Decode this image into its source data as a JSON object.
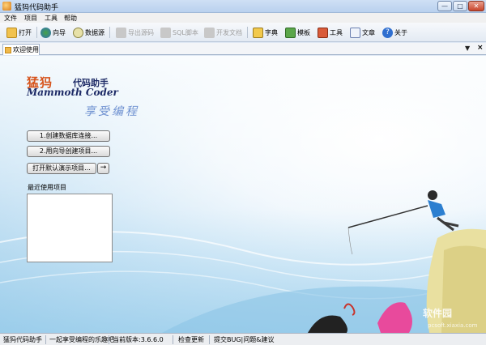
{
  "window": {
    "title": "猛犸代码助手",
    "min_glyph": "—",
    "max_glyph": "□",
    "close_glyph": "✕"
  },
  "menu": [
    "文件",
    "项目",
    "工具",
    "帮助"
  ],
  "toolbar": {
    "open": "打开",
    "wizard": "向导",
    "datasource": "数据源",
    "export_code": "导出源码",
    "sql_script": "SQL脚本",
    "dev_doc": "开发文档",
    "dictionary": "字典",
    "template": "模板",
    "tools": "工具",
    "article": "文章",
    "about": "关于"
  },
  "tabs": {
    "welcome": "欢迎使用",
    "arrow_glyph": "▼",
    "close_glyph": "×"
  },
  "welcome": {
    "logo_cn": "猛犸",
    "logo_cn_sub": "代码助手",
    "logo_en": "Mammoth Coder",
    "slogan": "享受编程",
    "btn_create_conn": "1.创建数据库连接...",
    "btn_wizard": "2.用向导创建项目...",
    "btn_demo": "打开默认演示项目...",
    "btn_arrow": "→",
    "recent_label": "最近使用项目"
  },
  "status": {
    "app": "猛犸代码助手",
    "tagline": "一起享受编程的乐趣吧",
    "version": "当前版本:3.6.6.0",
    "check_update": "检查更新",
    "submit_bug": "提交BUG|问题&建议"
  },
  "watermark": {
    "name": "软件园",
    "url": "pcsoft.xiaxia.com"
  },
  "colors": {
    "logo_orange": "#d6531b",
    "logo_navy": "#1d2a66",
    "sky": "#9fcdea"
  }
}
